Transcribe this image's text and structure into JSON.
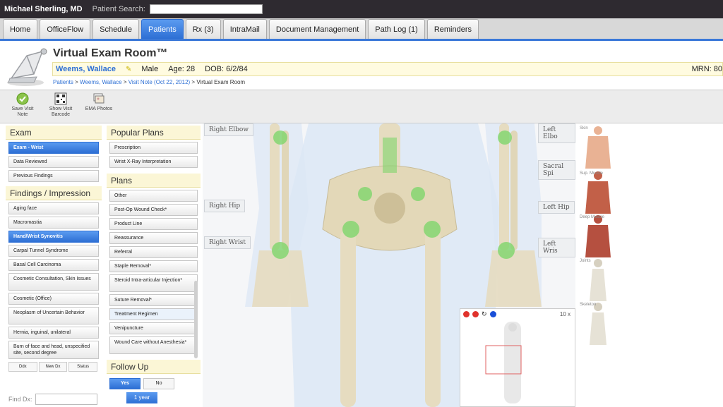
{
  "topbar": {
    "user": "Michael Sherling, MD",
    "search_label": "Patient Search:",
    "search_value": ""
  },
  "nav": {
    "tabs": [
      {
        "label": "Home"
      },
      {
        "label": "OfficeFlow"
      },
      {
        "label": "Schedule"
      },
      {
        "label": "Patients",
        "active": true
      },
      {
        "label": "Rx (3)"
      },
      {
        "label": "IntraMail"
      },
      {
        "label": "Document Management"
      },
      {
        "label": "Path Log (1)"
      },
      {
        "label": "Reminders"
      }
    ]
  },
  "header": {
    "title": "Virtual Exam Room™",
    "patient_name": "Weems, Wallace",
    "sex": "Male",
    "age": "Age: 28",
    "dob": "DOB: 6/2/84",
    "mrn": "MRN: 80",
    "breadcrumb": {
      "crumb1": "Patients",
      "sep1": " > ",
      "crumb2": "Weems, Wallace",
      "sep2": " > ",
      "crumb3": "Visit Note (Oct 22, 2012)",
      "sep3": " > ",
      "crumb4": "Virtual Exam Room"
    }
  },
  "toolbar": {
    "save_label": "Save Visit Note",
    "barcode_label": "Show Visit Barcode",
    "ema_label": "EMA Photos"
  },
  "exam": {
    "title": "Exam",
    "items": [
      "Exam - Wrist",
      "Data Reviewed",
      "Previous Findings"
    ]
  },
  "findings": {
    "title": "Findings / Impression",
    "items": [
      "Aging face",
      "Macromastia",
      "Hand/Wrist Synovitis",
      "Carpal Tunnel Syndrome",
      "Basal Cell Carcinoma",
      "Cosmetic Consultation, Skin Issues",
      "Cosmetic (Office)",
      "Neoplasm of Uncertain Behavior",
      "Hernia, inguinal, unilateral",
      "Burn of face and head, unspecified site, second degree"
    ],
    "buttons": [
      "Ddx",
      "New Dx",
      "Status"
    ],
    "find_label": "Find Dx:"
  },
  "popular_plans": {
    "title": "Popular Plans",
    "items": [
      "Prescription",
      "Wrist X-Ray Interpretation"
    ]
  },
  "plans": {
    "title": "Plans",
    "items": [
      "Other",
      "Post-Op Wound Check*",
      "Product Line",
      "Reassurance",
      "Referral",
      "Staple Removal*",
      "Steroid Intra-articular Injection*",
      "Suture Removal*",
      "Treatment Regimen",
      "Venipuncture",
      "Wound Care without Anesthesia*"
    ]
  },
  "follow_up": {
    "title": "Follow Up",
    "yes": "Yes",
    "no": "No",
    "period": "1 year"
  },
  "viewer": {
    "labels": {
      "right_elbow": "Right Elbow",
      "right_hip": "Right Hip",
      "right_wrist": "Right Wrist",
      "left_elbow": "Left Elbo",
      "sacral_spine": "Sacral Spi",
      "left_hip": "Left Hip",
      "left_wrist": "Left Wris"
    },
    "zoom": "10 x"
  },
  "layers": {
    "skin": "Skin",
    "sup_muscle": "Sup. Muscle",
    "deep_muscle": "Deep Muscle",
    "joints": "Joints",
    "skeleton": "Skeleton"
  }
}
